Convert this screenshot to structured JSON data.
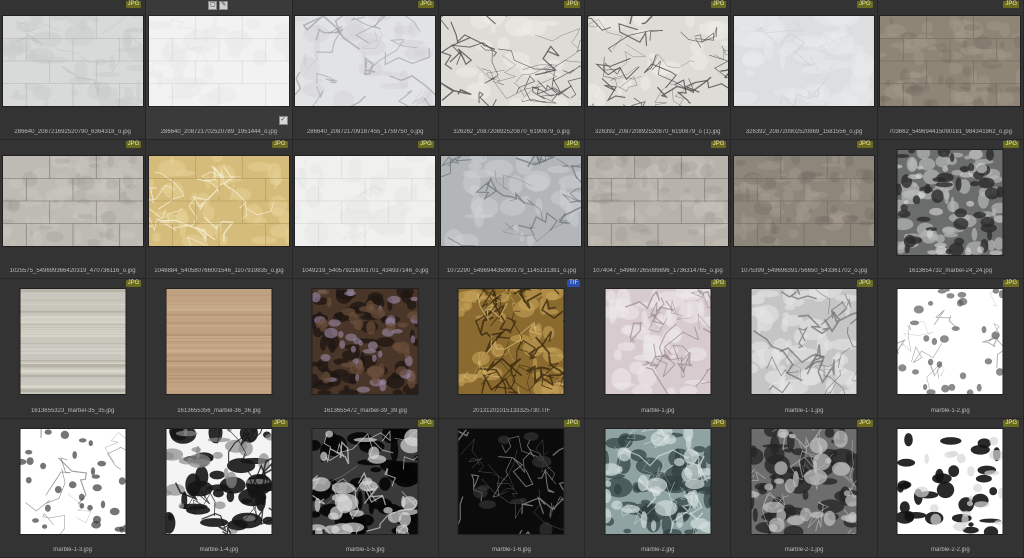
{
  "items": [
    {
      "name": "286640_208721692520790_6364318_o.jpg",
      "badge": "JPG",
      "shape": "wide",
      "tex": "cream-tiles",
      "c1": "#d8d9d9",
      "c2": "#b9bbbc",
      "c3": "#c9cbcc"
    },
    {
      "name": "286640_208721702520789_1951444_o.jpg",
      "badge": "",
      "shape": "wide",
      "tex": "white-tiles",
      "c1": "#f2f2f2",
      "c2": "#dedede",
      "c3": "#e9e9e9",
      "selected": true
    },
    {
      "name": "286640_208721709187455_1759750_o.jpg",
      "badge": "JPG",
      "shape": "wide",
      "tex": "vein",
      "c1": "#e2e3e4",
      "c2": "#9fa2a4",
      "c3": "#d3d4d5"
    },
    {
      "name": "326262_208720892520870_6190879_o.jpg",
      "badge": "JPG",
      "shape": "wide",
      "tex": "crackle",
      "c1": "#dedcd6",
      "c2": "#4a4a4a",
      "c3": "#ecebe6"
    },
    {
      "name": "326392_208720892520870_6190879_o (1).jpg",
      "badge": "JPG",
      "shape": "wide",
      "tex": "crackle",
      "c1": "#dedcd6",
      "c2": "#4a4a4a",
      "c3": "#ecebe6"
    },
    {
      "name": "326392_208720902520869_1581556_o.jpg",
      "badge": "JPG",
      "shape": "wide",
      "tex": "soft",
      "c1": "#dcdee0",
      "c2": "#c1c4c7",
      "c3": "#e8eaeb"
    },
    {
      "name": "703662_549694415090181_984341962_o.jpg",
      "badge": "JPG",
      "shape": "wide",
      "tex": "tiles",
      "c1": "#8f8577",
      "c2": "#6f675c",
      "c3": "#a49a8b"
    },
    {
      "name": "1025575_549699366420319_470736116_o.jpg",
      "badge": "JPG",
      "shape": "wide",
      "tex": "tiles",
      "c1": "#bdbbb4",
      "c2": "#9e9c95",
      "c3": "#cac8c1"
    },
    {
      "name": "1048884_540580766001546_1107919835_o.jpg",
      "badge": "JPG",
      "shape": "wide",
      "tex": "tiles-vein",
      "c1": "#d6bc7b",
      "c2": "#b99a55",
      "c3": "#e6d196"
    },
    {
      "name": "1049219_540579216001701_434937146_o.jpg",
      "badge": "JPG",
      "shape": "wide",
      "tex": "white-tiles",
      "c1": "#f0f0ef",
      "c2": "#d9d9d8",
      "c3": "#e7e7e6"
    },
    {
      "name": "1072290_549694435090179_1145131381_o.jpg",
      "badge": "JPG",
      "shape": "wide",
      "tex": "vein",
      "c1": "#b2b6b9",
      "c2": "#6b7074",
      "c3": "#cfd2d3"
    },
    {
      "name": "1074047_549697265089896_1736314765_o.jpg",
      "badge": "JPG",
      "shape": "wide",
      "tex": "tiles",
      "c1": "#b7b3ab",
      "c2": "#9a968e",
      "c3": "#c5c1b9"
    },
    {
      "name": "1075399_549696391756650_543361702_o.jpg",
      "badge": "JPG",
      "shape": "wide",
      "tex": "tiles",
      "c1": "#8d867a",
      "c2": "#6e685e",
      "c3": "#a39c8f"
    },
    {
      "name": "1613654732_marbel-24_24.jpg",
      "badge": "JPG",
      "shape": "square",
      "tex": "terrazzo",
      "c1": "#6b6d6c",
      "c2": "#2a2b2b",
      "c3": "#b5b8b7"
    },
    {
      "name": "1613655323_marbel-35_35.jpg",
      "badge": "JPG",
      "shape": "square",
      "tex": "travertine",
      "c1": "#c9c7bd",
      "c2": "#a7a496",
      "c3": "#dedbd1"
    },
    {
      "name": "1613655356_marbel-36_36.jpg",
      "badge": "",
      "shape": "square",
      "tex": "wood",
      "c1": "#c0a283",
      "c2": "#a58868",
      "c3": "#d2b696"
    },
    {
      "name": "1613655472_marbel-39_39.jpg",
      "badge": "",
      "shape": "square",
      "tex": "dark-stone",
      "c1": "#4a3629",
      "c2": "#1f1813",
      "c3": "#9c8aa8"
    },
    {
      "name": "20131201015133325730.TIF",
      "badge": "TIF",
      "shape": "square",
      "tex": "gold-crackle",
      "c1": "#8a6a2e",
      "c2": "#3c2a10",
      "c3": "#c7a45a"
    },
    {
      "name": "marble-1.jpg",
      "badge": "JPG",
      "shape": "square",
      "tex": "pink-marble",
      "c1": "#d7cbcf",
      "c2": "#8c7c82",
      "c3": "#ede7e9"
    },
    {
      "name": "marble-1-1.jpg",
      "badge": "JPG",
      "shape": "square",
      "tex": "grey-marble",
      "c1": "#c5c5c5",
      "c2": "#6e6e6e",
      "c3": "#e5e5e5"
    },
    {
      "name": "marble-1-2.jpg",
      "badge": "JPG",
      "shape": "square",
      "tex": "white-speck",
      "c1": "#ffffff",
      "c2": "#5a5a5a",
      "c3": "#eeeeee"
    },
    {
      "name": "marble-1-3.jpg",
      "badge": "",
      "shape": "square",
      "tex": "white-speck",
      "c1": "#ffffff",
      "c2": "#3a3a3a",
      "c3": "#e6e6e6"
    },
    {
      "name": "marble-1-4.jpg",
      "badge": "JPG",
      "shape": "square",
      "tex": "bw-marble",
      "c1": "#f4f4f4",
      "c2": "#151515",
      "c3": "#8a8a8a"
    },
    {
      "name": "marble-1-5.jpg",
      "badge": "JPG",
      "shape": "square",
      "tex": "bw-dark",
      "c1": "#3a3a3a",
      "c2": "#060606",
      "c3": "#d9d9d9"
    },
    {
      "name": "marble-1-6.jpg",
      "badge": "JPG",
      "shape": "square",
      "tex": "black-vein",
      "c1": "#0b0b0b",
      "c2": "#000000",
      "c3": "#8b8b8b"
    },
    {
      "name": "marble-2.jpg",
      "badge": "JPG",
      "shape": "square",
      "tex": "teal-marble",
      "c1": "#8fa3a3",
      "c2": "#2f3f40",
      "c3": "#d2dddc"
    },
    {
      "name": "marble-2-1.jpg",
      "badge": "JPG",
      "shape": "square",
      "tex": "grey-dark",
      "c1": "#6d6d6d",
      "c2": "#252525",
      "c3": "#c4c4c4"
    },
    {
      "name": "marble-2-2.jpg",
      "badge": "JPG",
      "shape": "square",
      "tex": "white-blot",
      "c1": "#ffffff",
      "c2": "#121212",
      "c3": "#d7d7d7"
    }
  ]
}
